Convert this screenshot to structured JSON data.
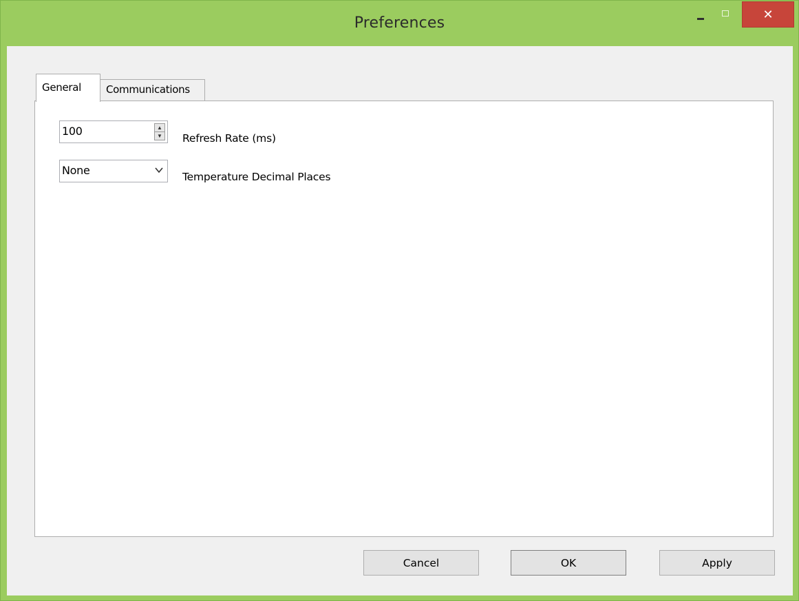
{
  "window": {
    "title": "Preferences",
    "controls": {
      "minimize_icon": "minimize-icon",
      "maximize_icon": "maximize-icon",
      "close_glyph": "✕"
    },
    "accent_color": "#9bcc5f",
    "close_color": "#c7453a"
  },
  "tabs": [
    {
      "label": "General",
      "selected": true
    },
    {
      "label": "Communications",
      "selected": false
    }
  ],
  "general": {
    "refresh_rate": {
      "value": "100",
      "label": "Refresh Rate (ms)"
    },
    "temperature_decimals": {
      "value": "None",
      "label": "Temperature Decimal Places"
    }
  },
  "buttons": {
    "cancel": "Cancel",
    "ok": "OK",
    "apply": "Apply"
  }
}
